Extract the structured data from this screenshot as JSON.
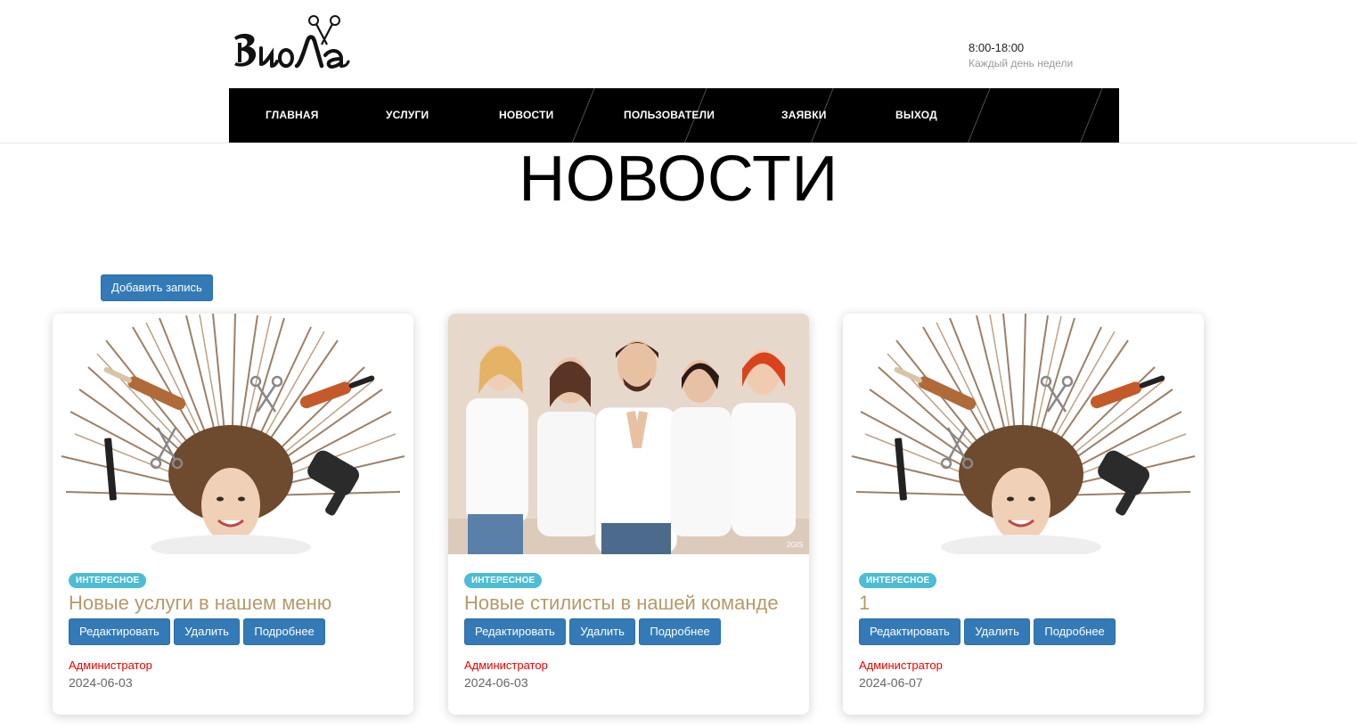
{
  "brand": {
    "logo_text": "ВиоЛа"
  },
  "hours": {
    "time": "8:00-18:00",
    "days": "Каждый день недели"
  },
  "nav": {
    "items": [
      {
        "label": "ГЛАВНАЯ"
      },
      {
        "label": "УСЛУГИ"
      },
      {
        "label": "НОВОСТИ"
      },
      {
        "label": "ПОЛЬЗОВАТЕЛИ"
      },
      {
        "label": "ЗАЯВКИ"
      },
      {
        "label": "ВЫХОД"
      }
    ]
  },
  "page": {
    "title": "НОВОСТИ",
    "add_button": "Добавить запись"
  },
  "colors": {
    "primary": "#337ab7",
    "badge": "#4dbcd5",
    "title": "#b49a6b",
    "author": "#ee0000",
    "nav_bg": "#000000"
  },
  "cards": [
    {
      "image": "hair-fan-woman-photo",
      "badge": "ИНТЕРЕСНОЕ",
      "title": "Новые услуги в нашем меню",
      "edit": "Редактировать",
      "delete": "Удалить",
      "more": "Подробнее",
      "author": "Администратор",
      "date": "2024-06-03"
    },
    {
      "image": "stylists-team-photo",
      "badge": "ИНТЕРЕСНОЕ",
      "title": "Новые стилисты в нашей команде",
      "edit": "Редактировать",
      "delete": "Удалить",
      "more": "Подробнее",
      "author": "Администратор",
      "date": "2024-06-03"
    },
    {
      "image": "hair-fan-woman-photo",
      "badge": "ИНТЕРЕСНОЕ",
      "title": "1",
      "edit": "Редактировать",
      "delete": "Удалить",
      "more": "Подробнее",
      "author": "Администратор",
      "date": "2024-06-07"
    }
  ]
}
